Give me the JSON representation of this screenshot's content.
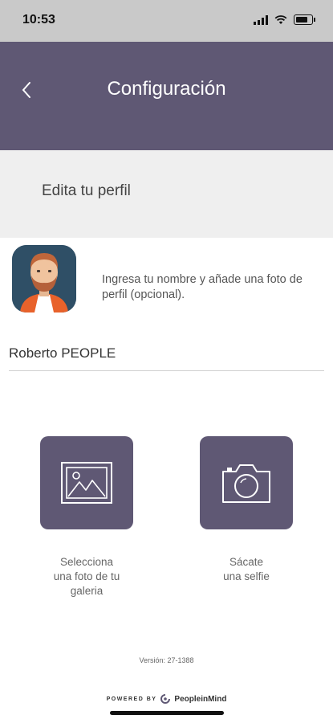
{
  "status_bar": {
    "time": "10:53"
  },
  "nav": {
    "title": "Configuración",
    "back_icon": "chevron-left-icon"
  },
  "section": {
    "title": "Edita tu perfil"
  },
  "profile": {
    "hint": "Ingresa tu nombre y añade una foto de perfil (opcional).",
    "name_value": "Roberto PEOPLE"
  },
  "actions": {
    "gallery_label": "Selecciona\nuna foto de tu\ngaleria",
    "selfie_label": "Sácate\nuna selfie"
  },
  "footer": {
    "version": "Versión: 27-1388",
    "powered_by": "POWERED BY",
    "brand": "PeopleinMind"
  },
  "colors": {
    "accent": "#5f5874",
    "status_bar": "#c9c9c9",
    "section_bg": "#efefef"
  }
}
